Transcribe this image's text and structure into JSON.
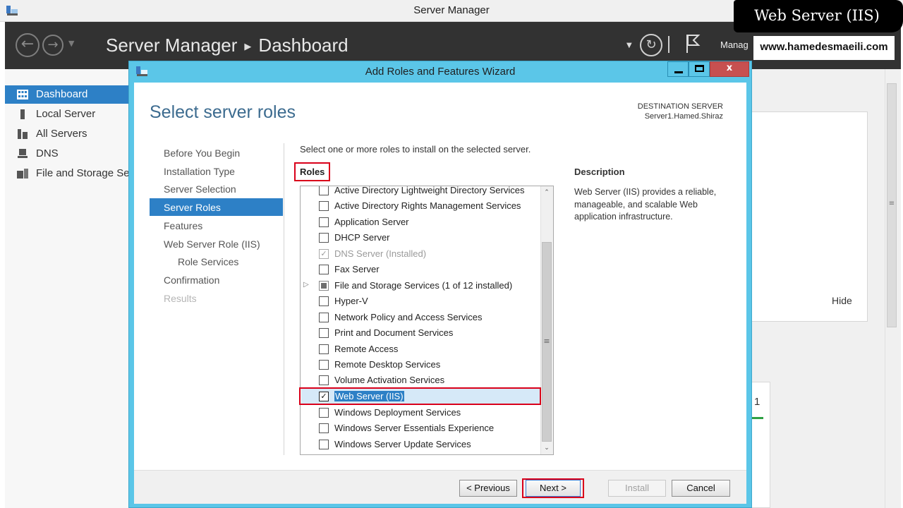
{
  "server_manager": {
    "window_title": "Server Manager",
    "breadcrumb": [
      "Server Manager",
      "Dashboard"
    ],
    "manage_label": "Manag",
    "sidebar": [
      {
        "label": "Dashboard",
        "icon": "dashboard-grid-icon",
        "active": true
      },
      {
        "label": "Local Server",
        "icon": "server-icon"
      },
      {
        "label": "All Servers",
        "icon": "servers-icon"
      },
      {
        "label": "DNS",
        "icon": "dns-icon"
      },
      {
        "label": "File and Storage Se",
        "icon": "file-storage-icon"
      }
    ],
    "hide_label": "Hide",
    "tile_count": "1"
  },
  "watermark": {
    "title": "Web Server (IIS)",
    "url": "www.hamedesmaeili.com"
  },
  "wizard": {
    "title": "Add Roles and Features Wizard",
    "close_symbol": "x",
    "page_title": "Select server roles",
    "destination_label": "DESTINATION SERVER",
    "destination_value": "Server1.Hamed.Shiraz",
    "steps": [
      {
        "label": "Before You Begin"
      },
      {
        "label": "Installation Type"
      },
      {
        "label": "Server Selection"
      },
      {
        "label": "Server Roles",
        "active": true
      },
      {
        "label": "Features"
      },
      {
        "label": "Web Server Role (IIS)"
      },
      {
        "label": "Role Services",
        "sub": true
      },
      {
        "label": "Confirmation"
      },
      {
        "label": "Results",
        "disabled": true
      }
    ],
    "instruction": "Select one or more roles to install on the selected server.",
    "roles_header": "Roles",
    "roles": [
      {
        "label": "Active Directory Lightweight Directory Services",
        "state": "unchecked"
      },
      {
        "label": "Active Directory Rights Management Services",
        "state": "unchecked"
      },
      {
        "label": "Application Server",
        "state": "unchecked"
      },
      {
        "label": "DHCP Server",
        "state": "unchecked"
      },
      {
        "label": "DNS Server (Installed)",
        "state": "installed"
      },
      {
        "label": "Fax Server",
        "state": "unchecked"
      },
      {
        "label": "File and Storage Services (1 of 12 installed)",
        "state": "partial",
        "expandable": true
      },
      {
        "label": "Hyper-V",
        "state": "unchecked"
      },
      {
        "label": "Network Policy and Access Services",
        "state": "unchecked"
      },
      {
        "label": "Print and Document Services",
        "state": "unchecked"
      },
      {
        "label": "Remote Access",
        "state": "unchecked"
      },
      {
        "label": "Remote Desktop Services",
        "state": "unchecked"
      },
      {
        "label": "Volume Activation Services",
        "state": "unchecked"
      },
      {
        "label": "Web Server (IIS)",
        "state": "checked",
        "selected": true
      },
      {
        "label": "Windows Deployment Services",
        "state": "unchecked"
      },
      {
        "label": "Windows Server Essentials Experience",
        "state": "unchecked"
      },
      {
        "label": "Windows Server Update Services",
        "state": "unchecked"
      }
    ],
    "description_header": "Description",
    "description_text": "Web Server (IIS) provides a reliable, manageable, and scalable Web application infrastructure.",
    "buttons": {
      "previous": "< Previous",
      "next": "Next >",
      "install": "Install",
      "cancel": "Cancel"
    }
  },
  "colors": {
    "wizard_frame": "#5bc6e8",
    "selection_blue": "#2d80c6",
    "highlight_red": "#d9001a",
    "header_dark": "#323232"
  }
}
